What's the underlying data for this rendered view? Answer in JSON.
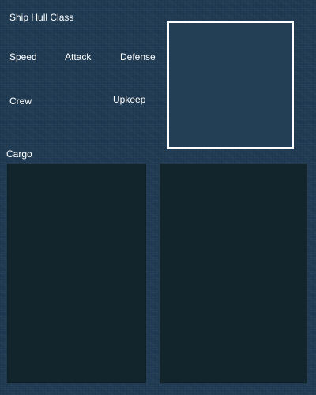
{
  "ship": {
    "title": "Ship Hull Class"
  },
  "stats": {
    "speed_label": "Speed",
    "attack_label": "Attack",
    "defense_label": "Defense",
    "crew_label": "Crew",
    "upkeep_label": "Upkeep"
  },
  "cargo": {
    "label": "Cargo"
  },
  "colors": {
    "background": "#1f3a52",
    "preview_fill": "#223f56",
    "preview_border": "#ffffff",
    "slot_fill": "#12242c",
    "text": "#ffffff"
  }
}
